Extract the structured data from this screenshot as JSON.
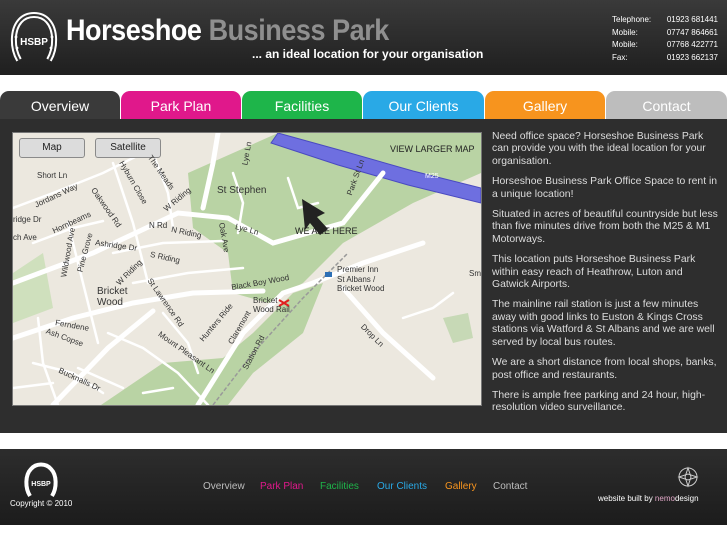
{
  "header": {
    "title_main": "Horseshoe",
    "title_park": "Business Park",
    "tagline": "... an ideal location for your organisation",
    "logo_text": "HSBP",
    "contacts": [
      {
        "label": "Telephone:",
        "value": "01923 681441"
      },
      {
        "label": "Mobile:",
        "value": "07747 864661"
      },
      {
        "label": "Mobile:",
        "value": "07768 422771"
      },
      {
        "label": "Fax:",
        "value": "01923 662137"
      }
    ]
  },
  "tabs": [
    {
      "label": "Overview",
      "color": "#3a3a3a"
    },
    {
      "label": "Park Plan",
      "color": "#e0188b"
    },
    {
      "label": "Facilities",
      "color": "#1eb54a"
    },
    {
      "label": "Our Clients",
      "color": "#29a9e6"
    },
    {
      "label": "Gallery",
      "color": "#f7941e"
    },
    {
      "label": "Contact",
      "color": "#bdbdbd"
    }
  ],
  "map": {
    "map_button": "Map",
    "satellite_button": "Satellite",
    "view_larger": "VIEW LARGER MAP",
    "we_are_here": "WE ARE HERE",
    "labels": {
      "st_stephen": "St Stephen",
      "bricket_wood": "Bricket\nWood",
      "premier_inn": "Premier Inn\nSt Albans /\nBricket Wood",
      "bricket_rail": "Bricket\nWood Rail",
      "m25": "M25",
      "short_ln": "Short Ln",
      "jordans_way": "Jordans Way",
      "oakwood_rd": "Oakwood Rd",
      "hyburn_close": "Hyburn Close",
      "the_meads": "The Meads",
      "w_riding": "W Riding",
      "n_riding": "N Riding",
      "s_riding": "S Riding",
      "lye_ln": "Lye Ln",
      "oak_ave": "Oak Ave",
      "park_st_ln": "Park St Ln",
      "ashridge_dr": "Ashridge Dr",
      "pine_grove": "Pine Grove",
      "black_boy_wood": "Black Boy Wood",
      "hunters_ride": "Hunters Ride",
      "claremont": "Claremont",
      "station_rd": "Station Rd",
      "drop_ln": "Drop Ln",
      "mount_pleasant_ln": "Mount Pleasant Ln",
      "st_lawrence_rd": "St Lawrence Rd",
      "ferndene": "Ferndene",
      "ash_copse": "Ash Copse",
      "bucknalls_dr": "Bucknalls Dr",
      "hornbeams": "Hornbeams",
      "bridge_dr": "ridge Dr",
      "ch_ave": "ch Ave",
      "wildwood_ave": "Wildwood Ave",
      "n_rd": "N Rd",
      "sm": "Sm"
    }
  },
  "content": {
    "paragraphs": [
      "Need office space? Horseshoe Business Park can provide you with the ideal location for your organisation.",
      "Horseshoe Business Park Office Space to rent in a unique location!",
      "Situated in acres of beautiful countryside but less than five minutes drive from both the M25 & M1 Motorways.",
      "This location puts Horseshoe Business Park within easy reach of Heathrow, Luton and Gatwick Airports.",
      "The mainline rail station is just a few minutes away with good links to Euston & Kings Cross stations via Watford & St Albans and we are well served by local bus routes.",
      "We are a short distance from local shops, banks, post office and restaurants.",
      "There is ample free parking and 24 hour, high-resolution video surveillance."
    ]
  },
  "footer": {
    "logo_text": "HSBP",
    "copyright": "Copyright © 2010",
    "nav": [
      {
        "label": "Overview",
        "color": "#bdbdbd"
      },
      {
        "label": "Park Plan",
        "color": "#e0188b"
      },
      {
        "label": "Facilities",
        "color": "#1eb54a"
      },
      {
        "label": "Our Clients",
        "color": "#29a9e6"
      },
      {
        "label": "Gallery",
        "color": "#f7941e"
      },
      {
        "label": "Contact",
        "color": "#bdbdbd"
      }
    ],
    "built_by": "website built by ",
    "nemo": "nemo",
    "design": "design"
  }
}
